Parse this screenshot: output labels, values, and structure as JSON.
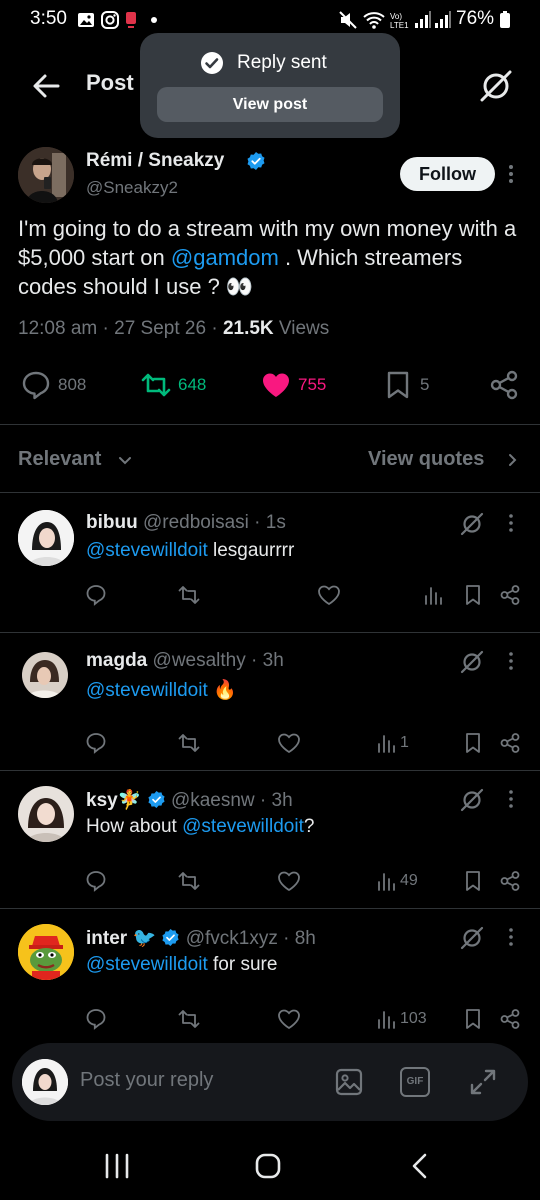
{
  "status_bar": {
    "time": "3:50",
    "battery": "76%",
    "icons": [
      "gallery-icon",
      "instagram-icon",
      "app-icon",
      "dot-icon",
      "mute-icon",
      "wifi-icon",
      "volte-icon",
      "signal-icon",
      "signal-icon",
      "battery-icon"
    ]
  },
  "header": {
    "title": "Post",
    "back_icon": "arrow-left-icon",
    "grok_icon": "grok-icon"
  },
  "toast": {
    "message": "Reply sent",
    "button": "View post"
  },
  "post": {
    "author_name": "Rémi / Sneakzy",
    "handle": "@Sneakzy2",
    "follow_label": "Follow",
    "text_before": "I'm going to do a stream with my own money with a $5,000 start on ",
    "mention": "@gamdom",
    "text_after": " . Which streamers codes should I use ? 👀",
    "time": "12:08 am",
    "date": "27 Sept 26",
    "views_count": "21.5K",
    "views_label": "Views",
    "replies": "808",
    "reposts": "648",
    "likes": "755",
    "bookmarks": "5",
    "colors": {
      "repost": "#00ba7c",
      "like": "#f91880",
      "link": "#1d9bf0"
    }
  },
  "sort": {
    "label": "Relevant",
    "view_quotes": "View quotes"
  },
  "replies": [
    {
      "name": "bibuu",
      "emoji": "",
      "verified": false,
      "handle": "@redboisasi",
      "time": "1s",
      "mention": "@stevewilldoit",
      "text": " lesgaurrrr",
      "views": ""
    },
    {
      "name": "magda",
      "emoji": "",
      "verified": false,
      "handle": "@wesalthy",
      "time": "3h",
      "mention": "@stevewilldoit",
      "text": " 🔥",
      "views": "1"
    },
    {
      "name": "ksy",
      "emoji": "🧚",
      "verified": true,
      "handle": "@kaesnw",
      "time": "3h",
      "prefix": "How about ",
      "mention": "@stevewilldoit",
      "text": "?",
      "views": "49"
    },
    {
      "name": "inter",
      "emoji": "🐦",
      "verified": true,
      "handle": "@fvck1xyz",
      "time": "8h",
      "mention": "@stevewilldoit",
      "text": " for sure",
      "views": "103"
    }
  ],
  "compose": {
    "placeholder": "Post your reply",
    "gif_label": "GIF"
  },
  "nav": {
    "icons": [
      "recents-icon",
      "home-icon",
      "back-icon"
    ]
  }
}
